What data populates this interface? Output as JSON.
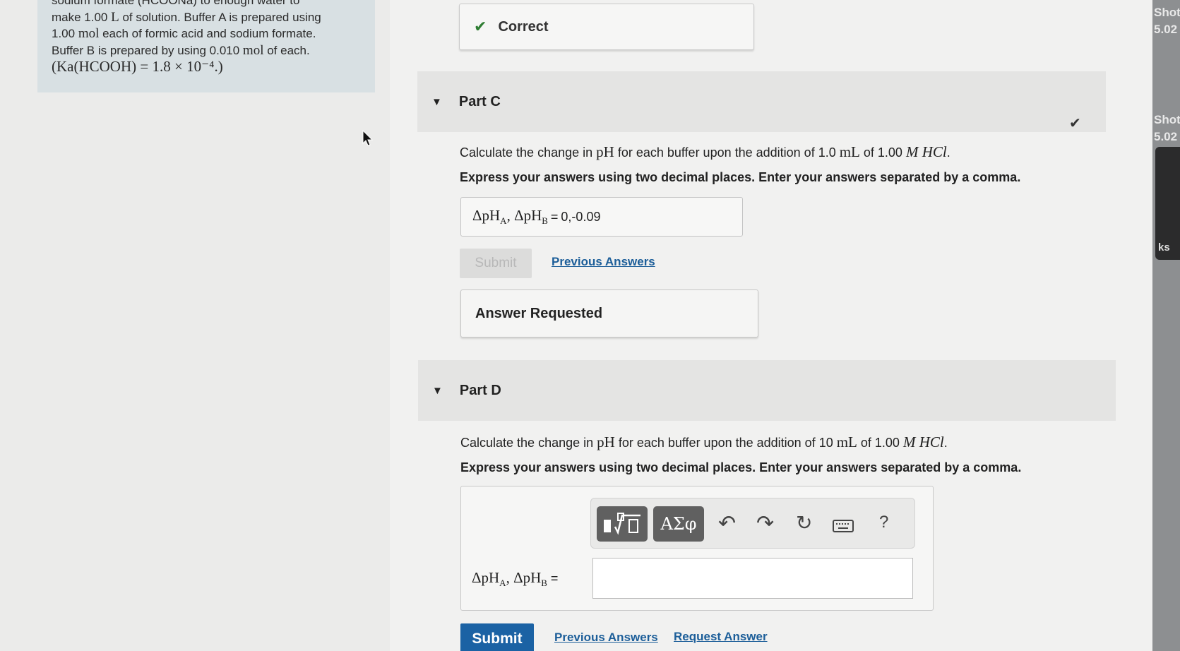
{
  "problem": {
    "line0": "sodium formate (HCOONa) to enough water to",
    "line1_a": "make 1.00 ",
    "line1_m": "L",
    "line1_b": " of solution. Buffer A is prepared using",
    "line2_a": "1.00 ",
    "line2_m": "mol",
    "line2_b": " each of formic acid and sodium formate.",
    "line3_a": "Buffer B is prepared by using 0.010 ",
    "line3_m": "mol",
    "line3_b": " of each.",
    "line4": "(Ka(HCOOH) = 1.8 × 10⁻⁴.)"
  },
  "correct_box": {
    "label": "Correct"
  },
  "partC": {
    "title": "Part C",
    "question_a": "Calculate the change in ",
    "question_m1": "pH",
    "question_b": " for each buffer upon the addition of 1.0 ",
    "question_m2": "mL",
    "question_c": " of 1.00 ",
    "question_m3": "M HCl",
    "question_d": ".",
    "instruction": "Express your answers using two decimal places. Enter your answers separated by a comma.",
    "answer_label_a": "ΔpH",
    "answer_sub_a": "A",
    "answer_sep": ", ΔpH",
    "answer_sub_b": "B",
    "answer_eq": " = ",
    "answer_value": "0,-0.09",
    "submit": "Submit",
    "previous_answers": "Previous Answers",
    "answer_requested": "Answer Requested"
  },
  "partD": {
    "title": "Part D",
    "question_a": "Calculate the change in ",
    "question_m1": "pH",
    "question_b": " for each buffer upon the addition of 10 ",
    "question_m2": "mL",
    "question_c": " of 1.00 ",
    "question_m3": "M HCl",
    "question_d": ".",
    "instruction": "Express your answers using two decimal places. Enter your answers separated by a comma.",
    "toolbar": {
      "greek": "ΑΣφ",
      "help": "?"
    },
    "answer_label_a": "ΔpH",
    "answer_sub_a": "A",
    "answer_sep": ", ΔpH",
    "answer_sub_b": "B",
    "answer_eq": " =",
    "answer_value": "",
    "submit": "Submit",
    "previous_answers": "Previous Answers",
    "request_answer": "Request Answer"
  },
  "side_strip": {
    "t1": "Shot",
    "t2": "5.02",
    "t3": "Shot",
    "t4": "5.02",
    "t5": "ks"
  }
}
